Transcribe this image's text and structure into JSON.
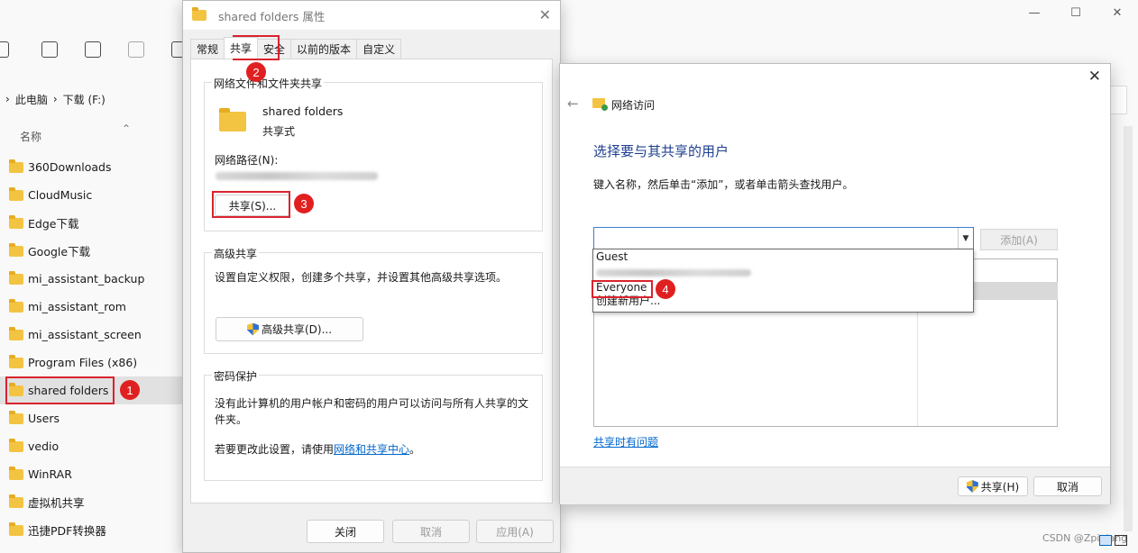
{
  "explorer": {
    "window_controls": [
      "—",
      "☐",
      "✕"
    ],
    "breadcrumb": [
      "此电脑",
      "下载 (F:)"
    ],
    "column_name": "名称",
    "folders": [
      {
        "name": "360Downloads",
        "selected": false
      },
      {
        "name": "CloudMusic",
        "selected": false
      },
      {
        "name": "Edge下载",
        "selected": false
      },
      {
        "name": "Google下载",
        "selected": false
      },
      {
        "name": "mi_assistant_backup",
        "selected": false
      },
      {
        "name": "mi_assistant_rom",
        "selected": false
      },
      {
        "name": "mi_assistant_screen",
        "selected": false
      },
      {
        "name": "Program Files (x86)",
        "selected": false
      },
      {
        "name": "shared folders",
        "selected": true
      },
      {
        "name": "Users",
        "selected": false
      },
      {
        "name": "vedio",
        "selected": false
      },
      {
        "name": "WinRAR",
        "selected": false
      },
      {
        "name": "虚拟机共享",
        "selected": false
      },
      {
        "name": "迅捷PDF转换器",
        "selected": false
      }
    ],
    "watermark": "CSDN @Zpiqiang"
  },
  "properties": {
    "title": "shared folders 属性",
    "tabs": [
      "常规",
      "共享",
      "安全",
      "以前的版本",
      "自定义"
    ],
    "active_tab": "共享",
    "network_group_title": "网络文件和文件夹共享",
    "folder_name": "shared folders",
    "folder_state": "共享式",
    "network_path_label": "网络路径(N):",
    "share_button": "共享(S)...",
    "advanced_group_title": "高级共享",
    "advanced_desc": "设置自定义权限，创建多个共享，并设置其他高级共享选项。",
    "advanced_button": "高级共享(D)...",
    "password_group_title": "密码保护",
    "password_desc_1": "没有此计算机的用户帐户和密码的用户可以访问与所有人共享的文",
    "password_desc_2": "件夹。",
    "password_change_prefix": "若要更改此设置，请使用",
    "password_link": "网络和共享中心",
    "password_change_suffix": "。",
    "ok_button": "关闭",
    "cancel_button": "取消",
    "apply_button": "应用(A)"
  },
  "wizard": {
    "title": "网络访问",
    "heading": "选择要与其共享的用户",
    "instruction": "键入名称，然后单击“添加”，或者单击箭头查找用户。",
    "add_button": "添加(A)",
    "dropdown_items": [
      "Guest",
      "Everyone",
      "创建新用户..."
    ],
    "help_link": "共享时有问题",
    "share_button": "共享(H)",
    "cancel_button": "取消"
  },
  "annotations": [
    "1",
    "2",
    "3",
    "4"
  ],
  "colors": {
    "annotation_red": "#d9232d",
    "link_blue": "#0066cc",
    "heading_blue": "#1e3f8f",
    "folder_yellow": "#f3c442"
  }
}
